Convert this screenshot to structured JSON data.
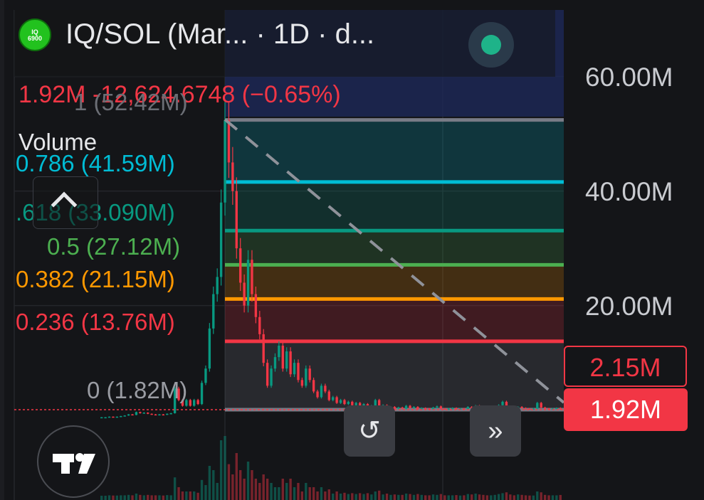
{
  "header": {
    "logo_text": "IQ\n6900",
    "title": "IQ/SOL (Mar...  · 1D · d...",
    "status_color": "#1eb389"
  },
  "price_change": {
    "text": "1.92M  -12,624.6748 (−0.65%)",
    "color": "#f23645"
  },
  "indicator": {
    "volume_label": "Volume"
  },
  "fib_labels": [
    {
      "text": "1 (52.42M)",
      "color": "#6b6e75"
    },
    {
      "text": "0.786 (41.59M)",
      "color": "#00bcd4"
    },
    {
      "text": ".618 (33.090M)",
      "color": "#089981"
    },
    {
      "text": "0.5 (27.12M)",
      "color": "#4caf50"
    },
    {
      "text": "0.382 (21.15M)",
      "color": "#ff9800"
    },
    {
      "text": "0.236 (13.76M)",
      "color": "#f23645"
    },
    {
      "text": "0 (1.82M)",
      "color": "#9a9ca3"
    }
  ],
  "price_axis": {
    "labels": [
      "60.00M",
      "40.00M",
      "20.00M"
    ]
  },
  "price_tags": {
    "high": "2.15M",
    "last": "1.92M"
  },
  "controls": {
    "reset_icon": "reset-icon",
    "scroll_icon": "scroll-to-latest-icon",
    "reset_glyph": "↺",
    "scroll_glyph": "»",
    "brand_icon": "tradingview-logo-icon"
  },
  "chart_data": {
    "type": "candlestick",
    "symbol": "IQ/SOL",
    "interval": "1D",
    "ylim": [
      0,
      62
    ],
    "y_unit": "M",
    "grid": true,
    "fib_retracement": {
      "high": 52.42,
      "low": 1.82,
      "levels": [
        {
          "ratio": 1,
          "value": 52.42,
          "color": "#787b86"
        },
        {
          "ratio": 0.786,
          "value": 41.59,
          "color": "#00bcd4"
        },
        {
          "ratio": 0.618,
          "value": 33.09,
          "color": "#089981"
        },
        {
          "ratio": 0.5,
          "value": 27.12,
          "color": "#4caf50"
        },
        {
          "ratio": 0.382,
          "value": 21.15,
          "color": "#ff9800"
        },
        {
          "ratio": 0.236,
          "value": 13.76,
          "color": "#f23645"
        },
        {
          "ratio": 0,
          "value": 1.82,
          "color": "#787b86"
        }
      ]
    },
    "last_price": 1.92,
    "high_marker": 2.15,
    "up_color": "#089981",
    "down_color": "#f23645",
    "closes": [
      0.5,
      0.5,
      0.6,
      0.55,
      0.6,
      0.7,
      0.8,
      1.0,
      0.9,
      1.4,
      1.2,
      1.3,
      1.1,
      1.0,
      0.9,
      1.0,
      0.95,
      1.1,
      1.2,
      5.5,
      3.5,
      2.5,
      3.5,
      2.5,
      3.5,
      2.8,
      6.5,
      9,
      16,
      22,
      25,
      38,
      52.4,
      45,
      40,
      30,
      24,
      20,
      28,
      22,
      18,
      15,
      10,
      6,
      9,
      11,
      13,
      9,
      12,
      8,
      10,
      7,
      6,
      9,
      7,
      5,
      4,
      6,
      5,
      3.5,
      4,
      3,
      3.5,
      2.8,
      3.2,
      2.6,
      3,
      2.4,
      2.8,
      2.2,
      2.5,
      3.5,
      2.3,
      2.6,
      2.1,
      2.3,
      2.0,
      2.2,
      2.0,
      2.5,
      2.1,
      2.3,
      1.9,
      2.1,
      2.0,
      1.9,
      2.2,
      2.4,
      2.0,
      1.9,
      2.0,
      2.1,
      1.95,
      2.0,
      1.9,
      2.3,
      2.0,
      2.5,
      2.2,
      2.0,
      1.9,
      2.0,
      2.2,
      2.6,
      3.2,
      2.4,
      2.1,
      2.0,
      2.3,
      2.1,
      2.0,
      1.95,
      2.0,
      3.0,
      2.2,
      2.0,
      1.9,
      2.0,
      2.1,
      1.92
    ]
  }
}
